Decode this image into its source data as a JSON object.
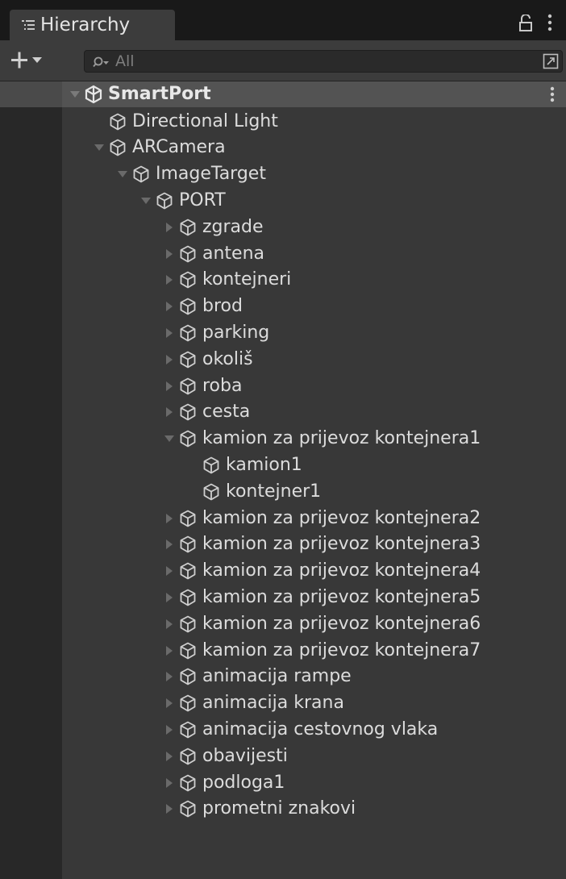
{
  "panel": {
    "tab_label": "Hierarchy",
    "tab_icon": "hierarchy-list-icon",
    "lock_icon": "lock-icon",
    "menu_icon": "kebab-menu-icon"
  },
  "toolbar": {
    "add_icon": "plus-dropdown-icon",
    "search_icon": "search-filter-icon",
    "search_placeholder": "All",
    "search_value": "",
    "expand_icon": "expand-window-icon"
  },
  "scene": {
    "name": "SmartPort",
    "icon": "unity-scene-icon",
    "expanded": true,
    "menu_icon": "kebab-menu-icon"
  },
  "tree_items": [
    {
      "label": "Directional Light",
      "depth": 1,
      "arrow": "none"
    },
    {
      "label": "ARCamera",
      "depth": 1,
      "arrow": "expanded"
    },
    {
      "label": "ImageTarget",
      "depth": 2,
      "arrow": "expanded"
    },
    {
      "label": "PORT",
      "depth": 3,
      "arrow": "expanded"
    },
    {
      "label": "zgrade",
      "depth": 4,
      "arrow": "collapsed"
    },
    {
      "label": "antena",
      "depth": 4,
      "arrow": "collapsed"
    },
    {
      "label": "kontejneri",
      "depth": 4,
      "arrow": "collapsed"
    },
    {
      "label": "brod",
      "depth": 4,
      "arrow": "collapsed"
    },
    {
      "label": "parking",
      "depth": 4,
      "arrow": "collapsed"
    },
    {
      "label": "okoliš",
      "depth": 4,
      "arrow": "collapsed"
    },
    {
      "label": "roba",
      "depth": 4,
      "arrow": "collapsed"
    },
    {
      "label": "cesta",
      "depth": 4,
      "arrow": "collapsed"
    },
    {
      "label": "kamion za prijevoz kontejnera1",
      "depth": 4,
      "arrow": "expanded"
    },
    {
      "label": "kamion1",
      "depth": 5,
      "arrow": "none"
    },
    {
      "label": "kontejner1",
      "depth": 5,
      "arrow": "none"
    },
    {
      "label": "kamion za prijevoz kontejnera2",
      "depth": 4,
      "arrow": "collapsed"
    },
    {
      "label": "kamion za prijevoz kontejnera3",
      "depth": 4,
      "arrow": "collapsed"
    },
    {
      "label": "kamion za prijevoz kontejnera4",
      "depth": 4,
      "arrow": "collapsed"
    },
    {
      "label": "kamion za prijevoz kontejnera5",
      "depth": 4,
      "arrow": "collapsed"
    },
    {
      "label": "kamion za prijevoz kontejnera6",
      "depth": 4,
      "arrow": "collapsed"
    },
    {
      "label": "kamion za prijevoz kontejnera7",
      "depth": 4,
      "arrow": "collapsed"
    },
    {
      "label": "animacija rampe",
      "depth": 4,
      "arrow": "collapsed"
    },
    {
      "label": "animacija krana",
      "depth": 4,
      "arrow": "collapsed"
    },
    {
      "label": "animacija cestovnog vlaka",
      "depth": 4,
      "arrow": "collapsed"
    },
    {
      "label": "obavijesti",
      "depth": 4,
      "arrow": "collapsed"
    },
    {
      "label": "podloga1",
      "depth": 4,
      "arrow": "collapsed"
    },
    {
      "label": "prometni znakovi",
      "depth": 4,
      "arrow": "collapsed"
    }
  ],
  "item_icon": "gameobject-cube-icon",
  "colors": {
    "panel_bg": "#383838",
    "scene_row_bg": "#535353",
    "text": "#dcdcdc",
    "arrow": "#6e6e6e"
  }
}
